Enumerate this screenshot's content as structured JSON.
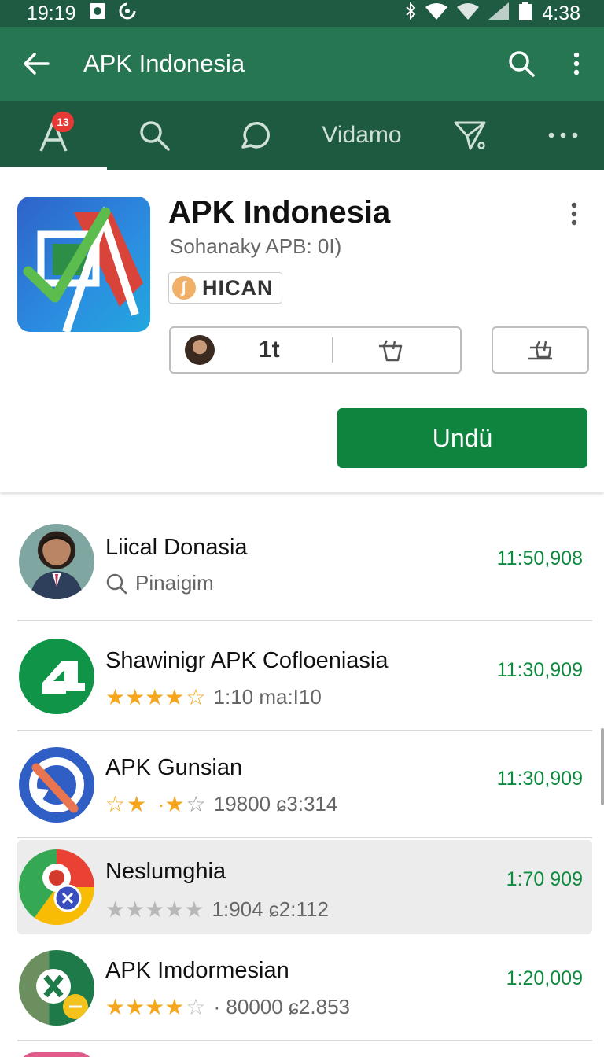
{
  "status_bar": {
    "time": "19:19",
    "battery_time": "4:38"
  },
  "app_bar": {
    "title": "APK Indonesia"
  },
  "tabs": [
    {
      "name": "apps",
      "badge": "13"
    },
    {
      "name": "search"
    },
    {
      "name": "chat"
    },
    {
      "name": "vidamo",
      "label": "Vidamo"
    },
    {
      "name": "send"
    },
    {
      "name": "more"
    }
  ],
  "hero": {
    "title": "APK Indonesia",
    "subtitle": "Sohanaky APB: 0I)",
    "tag": "HICAN",
    "count": "1t",
    "install_label": "Undü"
  },
  "list": [
    {
      "title": "Liical Donasia",
      "subtitle": "Pinaigim",
      "value": "11:50,908"
    },
    {
      "title": "Shawinigr APK Cofloeniasia",
      "rating": 4,
      "meta": "1:10  ma:I10",
      "value": "11:30,909"
    },
    {
      "title": "APK Gunsian",
      "rating": 2,
      "meta": "19800 ɕ3:314",
      "value": "11:30,909"
    },
    {
      "title": "Neslumghia",
      "rating": 0,
      "meta": "1:904 ɕ2:112",
      "value": "1:70 909"
    },
    {
      "title": "APK Imdormesian",
      "rating": 4,
      "meta": "· 80000 ɕ2.853",
      "value": "1:20,009"
    }
  ],
  "colors": {
    "app_bar": "#267652",
    "tab_bar": "#1d5a40",
    "install": "#0e843f",
    "value": "#0e8a3e",
    "star": "#f4a61c"
  }
}
